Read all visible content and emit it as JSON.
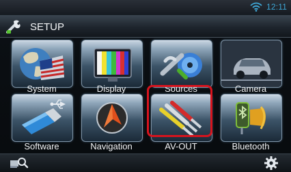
{
  "status": {
    "time": "12:11"
  },
  "header": {
    "title": "SETUP"
  },
  "tiles": [
    {
      "label": "System",
      "icon": "globe-flag-icon"
    },
    {
      "label": "Display",
      "icon": "display-icon"
    },
    {
      "label": "Sources",
      "icon": "sources-icon"
    },
    {
      "label": "Camera",
      "icon": "camera-car-icon"
    },
    {
      "label": "Software",
      "icon": "usb-drive-icon"
    },
    {
      "label": "Navigation",
      "icon": "navigation-icon"
    },
    {
      "label": "AV-OUT",
      "icon": "av-cables-icon",
      "highlighted": true
    },
    {
      "label": "Bluetooth",
      "icon": "bluetooth-icon"
    }
  ],
  "colors": {
    "accent": "#3fa9d8",
    "highlight": "#d8131d"
  }
}
